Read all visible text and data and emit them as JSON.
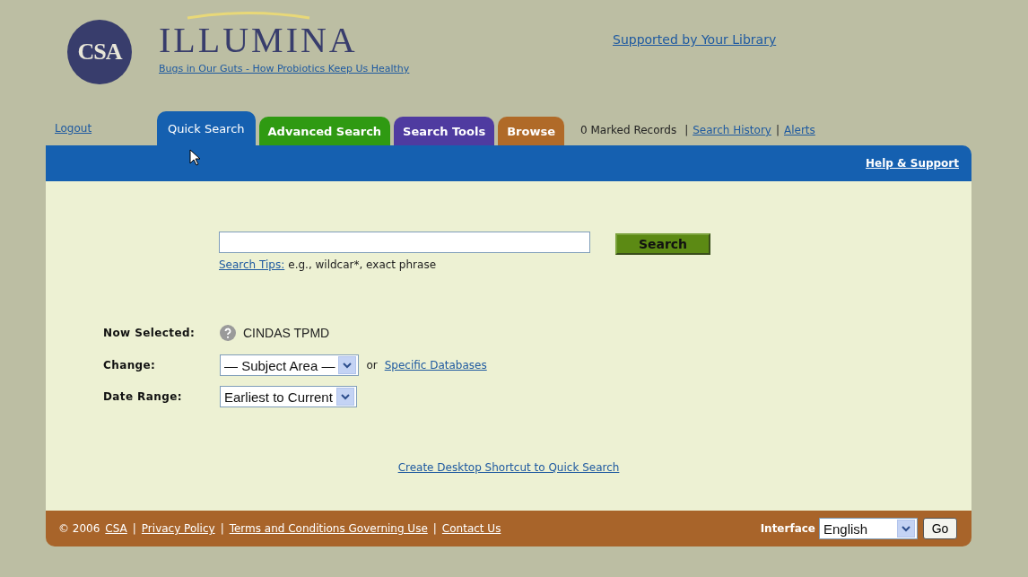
{
  "header": {
    "logo_mark": "CSA",
    "logo_name": "ILLUMINA",
    "feature_link": "Bugs in Our Guts - How Probiotics Keep Us Healthy",
    "support_link": "Supported by Your Library"
  },
  "nav": {
    "logout": "Logout",
    "tabs": [
      {
        "label": "Quick Search",
        "selected": true,
        "color": "#1560b0"
      },
      {
        "label": "Advanced Search",
        "selected": false,
        "color": "#2f9a12"
      },
      {
        "label": "Search Tools",
        "selected": false,
        "color": "#4f3ba0"
      },
      {
        "label": "Browse",
        "selected": false,
        "color": "#b06a28"
      }
    ],
    "marked": "0 Marked Records",
    "separator": "|",
    "links": [
      "Search History",
      "Alerts"
    ],
    "help": "Help & Support"
  },
  "search": {
    "button": "Search",
    "tips_link": "Search Tips:",
    "tips_text": "e.g., wildcar*, exact phrase"
  },
  "form": {
    "now_selected_label": "Now Selected:",
    "now_selected_value": "CINDAS TPMD",
    "change_label": "Change:",
    "change_value": "— Subject Area —",
    "or": "or",
    "specific_link": "Specific Databases",
    "date_label": "Date Range:",
    "date_value": "Earliest to Current"
  },
  "shortcut_link": "Create Desktop Shortcut to Quick Search",
  "footer": {
    "items": [
      {
        "kind": "text",
        "text": "© 2006"
      },
      {
        "kind": "link",
        "text": "CSA"
      },
      {
        "kind": "sep",
        "text": "|"
      },
      {
        "kind": "link",
        "text": "Privacy Policy"
      },
      {
        "kind": "sep",
        "text": "|"
      },
      {
        "kind": "link",
        "text": "Terms and Conditions Governing Use"
      },
      {
        "kind": "sep",
        "text": "|"
      },
      {
        "kind": "link",
        "text": "Contact Us"
      }
    ],
    "interface_label": "Interface",
    "language": "English",
    "go": "Go"
  }
}
